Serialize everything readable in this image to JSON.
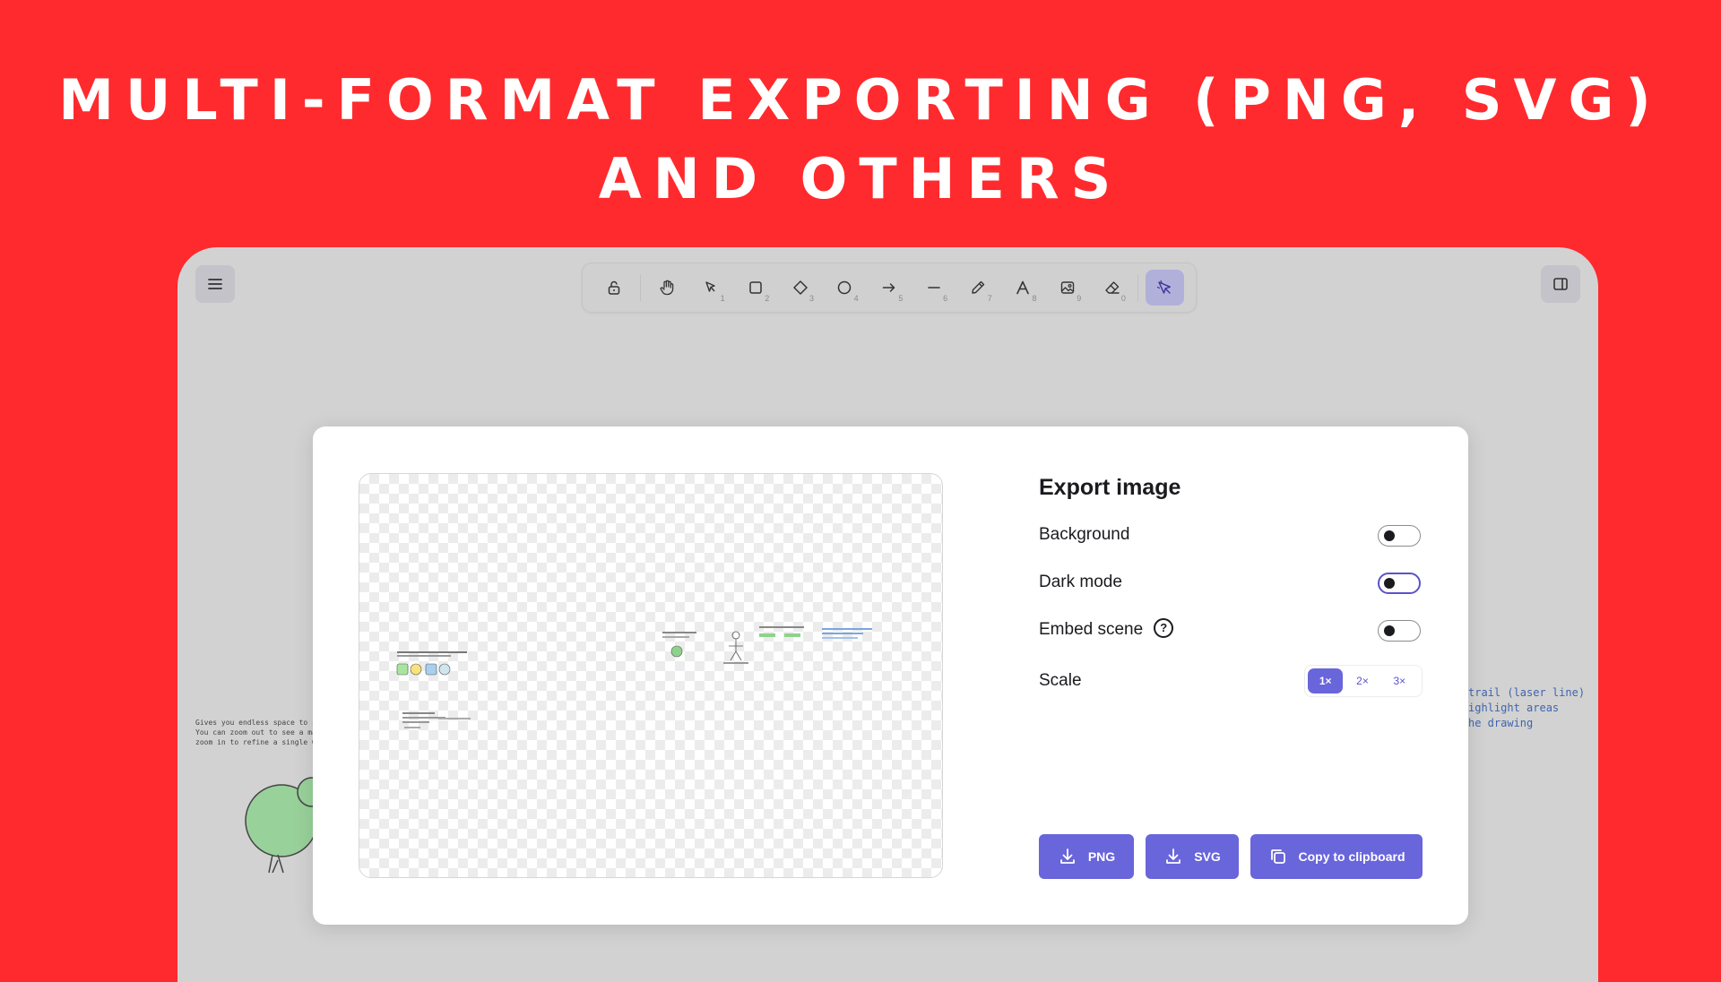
{
  "headline": {
    "line1": "MULTI-FORMAT EXPORTING (PNG, SVG)",
    "line2": "AND OTHERS"
  },
  "toolbar": {
    "keys": [
      "1",
      "2",
      "3",
      "4",
      "5",
      "6",
      "7",
      "8",
      "9",
      "0"
    ]
  },
  "canvas_notes": {
    "left": "Gives you endless space to sketch\nYou can zoom out to see a massive\nzoom in to refine a single wireframe",
    "right": "trail (laser line)\nighlight areas\nhe drawing"
  },
  "export_dialog": {
    "title": "Export image",
    "background_label": "Background",
    "dark_mode_label": "Dark mode",
    "embed_scene_label": "Embed scene",
    "help_glyph": "?",
    "scale_label": "Scale",
    "scale_options": [
      "1×",
      "2×",
      "3×"
    ],
    "png_label": "PNG",
    "svg_label": "SVG",
    "copy_label": "Copy to clipboard"
  },
  "colors": {
    "brand_red": "#ff2a2d",
    "accent_purple": "#6965db"
  }
}
